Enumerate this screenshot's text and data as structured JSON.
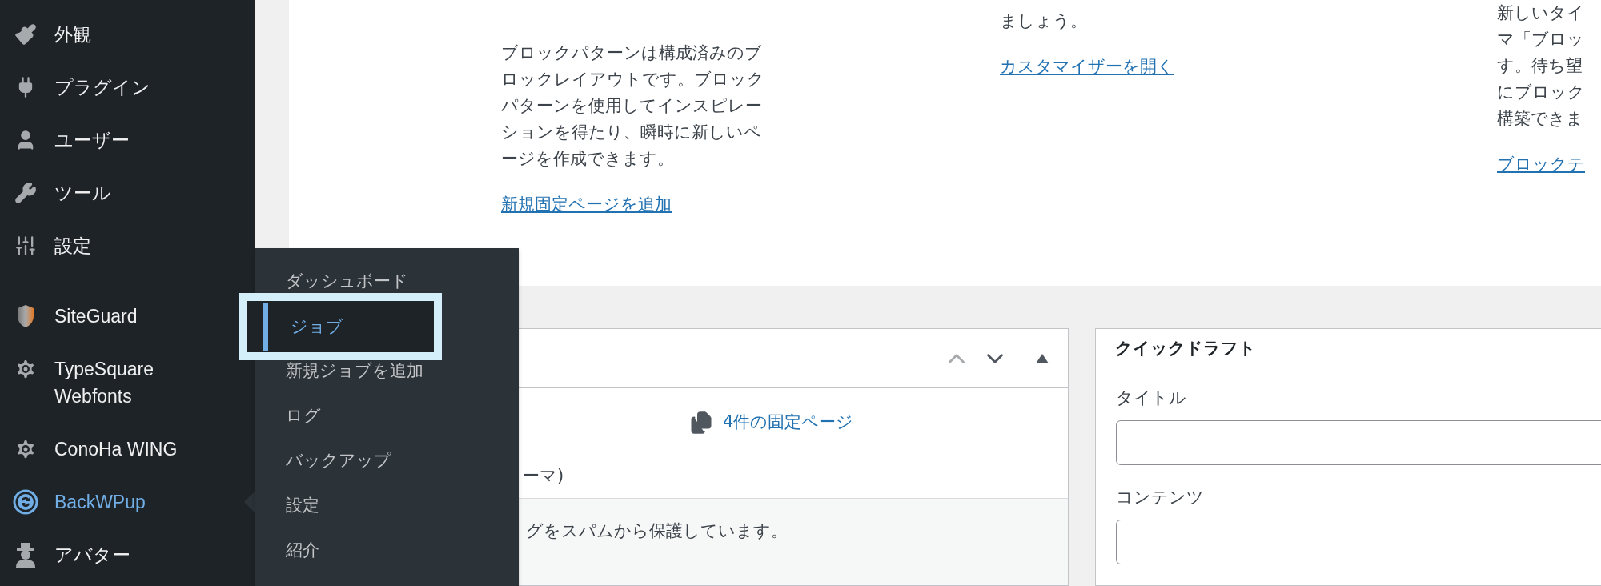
{
  "sidebar": {
    "groups": [
      [
        {
          "label": "外観",
          "selected": false
        },
        {
          "label": "プラグイン",
          "selected": false
        },
        {
          "label": "ユーザー",
          "selected": false
        },
        {
          "label": "ツール",
          "selected": false
        },
        {
          "label": "設定",
          "selected": false
        }
      ],
      [
        {
          "label": "SiteGuard",
          "selected": false
        },
        {
          "label": "TypeSquare Webfonts",
          "selected": false
        },
        {
          "label": "ConoHa WING",
          "selected": false
        },
        {
          "label": "BackWPup",
          "selected": true
        },
        {
          "label": "アバター",
          "selected": false
        }
      ]
    ]
  },
  "welcome": {
    "columns": [
      {
        "lines": [
          "ブロックパターンは構成済みのブ",
          "ロックレイアウトです。ブロック",
          "パターンを使用してインスピレー",
          "ションを得たり、瞬時に新しいペ",
          "ージを作成できます。"
        ],
        "link": "新規固定ページを追加"
      },
      {
        "lines": [
          "ましょう。"
        ],
        "link": "カスタマイザーを開く"
      },
      {
        "lines": [
          "新しいタイ",
          "マ「ブロッ",
          "す。待ち望",
          "にブロック",
          "構築できま"
        ],
        "link": "ブロックテ"
      }
    ]
  },
  "glance_box": {
    "pages_link": "4件の固定ページ",
    "theme_text": "ーマ)",
    "footer": "グをスパムから保護しています。"
  },
  "quick_draft": {
    "title": "クイックドラフト",
    "fields": [
      {
        "label": "タイトル"
      },
      {
        "label": "コンテンツ"
      }
    ]
  },
  "flyout": {
    "items": [
      {
        "label": "ダッシュボード",
        "selected": false
      },
      {
        "label": "ジョブ",
        "selected": true
      },
      {
        "label": "新規ジョブを追加",
        "selected": false
      },
      {
        "label": "ログ",
        "selected": false
      },
      {
        "label": "バックアップ",
        "selected": false
      },
      {
        "label": "設定",
        "selected": false
      },
      {
        "label": "紹介",
        "selected": false
      }
    ]
  }
}
